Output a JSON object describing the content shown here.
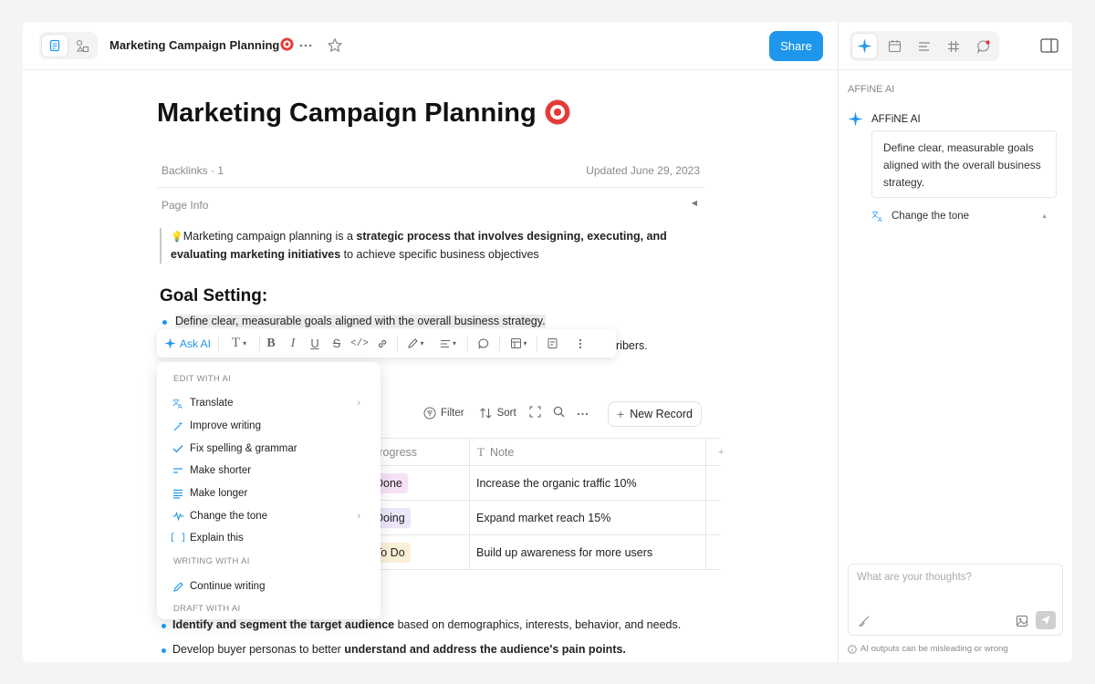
{
  "app": {
    "doc_title": "Marketing Campaign Planning",
    "share_label": "Share"
  },
  "doc": {
    "title": "Marketing Campaign Planning",
    "backlinks": "Backlinks · 1",
    "updated": "Updated June 29, 2023",
    "page_info": "Page Info",
    "quote": {
      "emoji": "💡",
      "text_1": "Marketing campaign planning is a ",
      "bold": "strategic process that involves designing, executing, and evaluating marketing initiatives",
      "text_2": " to achieve specific business objectives"
    },
    "heading": "Goal Setting:",
    "bullet_1": "Define clear, measurable goals aligned with the overall business strategy.",
    "bullet_2_tail": "ribers.",
    "bottom_bullets": [
      {
        "bold": "Identify and segment the target audience",
        "text": " based on demographics, interests, behavior, and needs."
      },
      {
        "text": "Develop buyer personas to better ",
        "bold": "understand and address the audience's pain points."
      }
    ]
  },
  "format_toolbar": {
    "ask_ai": "Ask AI"
  },
  "database": {
    "filter": "Filter",
    "sort": "Sort",
    "new_record": "New Record",
    "columns": [
      "Progress",
      "Note"
    ],
    "rows": [
      {
        "progress": "Done",
        "progress_color": "#f6e1f7",
        "note": "Increase the organic traffic 10%"
      },
      {
        "progress": "Doing",
        "progress_color": "#ece6f9",
        "note": "Expand market reach 15%"
      },
      {
        "progress": "To Do",
        "progress_color": "#fdf0d8",
        "note": "Build up awareness for more users"
      }
    ]
  },
  "ai_menu": {
    "section_edit": "EDIT WITH AI",
    "items_edit": [
      {
        "label": "Translate",
        "icon": "translate-icon",
        "submenu": true
      },
      {
        "label": "Improve writing",
        "icon": "magic-wand-icon",
        "submenu": false
      },
      {
        "label": "Fix spelling & grammar",
        "icon": "check-icon",
        "submenu": false
      },
      {
        "label": "Make shorter",
        "icon": "short-text-icon",
        "submenu": false
      },
      {
        "label": "Make longer",
        "icon": "long-text-icon",
        "submenu": false
      },
      {
        "label": "Change the tone",
        "icon": "tone-wave-icon",
        "submenu": true
      },
      {
        "label": "Explain this",
        "icon": "brackets-icon",
        "submenu": false
      }
    ],
    "section_write": "WRITING WITH AI",
    "item_continue": "Continue writing",
    "section_draft": "DRAFT WITH AI"
  },
  "sidebar": {
    "panel_label": "AFFiNE AI",
    "assistant_name": "AFFiNE AI",
    "quoted_text": "Define clear, measurable goals aligned with the overall business strategy.",
    "action": "Change the tone",
    "input_placeholder": "What are your thoughts?",
    "disclaimer": "AI outputs can be misleading or wrong"
  },
  "colors": {
    "accent": "#1e96eb",
    "done": "#f6e1f7",
    "doing": "#ece6f9",
    "todo": "#fdf0d8"
  }
}
